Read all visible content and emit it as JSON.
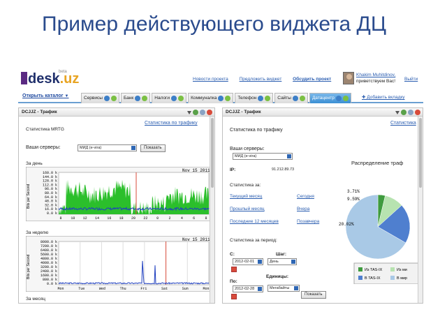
{
  "slide_title": "Пример действующего виджета ДЦ",
  "site": {
    "logo_text": "desk",
    "logo_tld": ".uz",
    "beta": "beta",
    "top_links": [
      "Новости проекта",
      "Предложить виджет",
      "Обсудить проект"
    ],
    "user_name": "Khakim Muhitdinov,",
    "greeting": "приветствуем Вас!",
    "logout": "Выйти",
    "open_catalog": "Открыть каталог",
    "tabs": [
      "Сервисы",
      "Банк",
      "Налоги",
      "Коммуналка",
      "Телефон",
      "Сайты",
      "Датацентр"
    ],
    "active_tab": "Датацентр",
    "add_tab": "Добавить вкладку"
  },
  "left_widget": {
    "title": "DCJJZ - Трафик",
    "stats_link": "Статистика по трафику",
    "heading": "Статистика MRTG",
    "servers_label": "Ваши серверы:",
    "server_value": "МИД (e-vira)",
    "show_button": "Показать",
    "day_label": "За день",
    "week_label": "За неделю",
    "month_label": "За месяц",
    "day_date": "Nov 15 2011",
    "week_date": "Nov 15 2011",
    "day_y_ticks": [
      "160.0 k",
      "144.0 k",
      "128.0 k",
      "112.0 k",
      "96.0 k",
      "80.0 k",
      "64.0 k",
      "48.0 k",
      "32.0 k",
      "16.0 k",
      "0.0 k"
    ],
    "day_x_ticks": [
      "8",
      "10",
      "12",
      "14",
      "16",
      "18",
      "20",
      "22",
      "0",
      "2",
      "4",
      "6",
      "8"
    ],
    "week_y_ticks": [
      "8000.0 k",
      "7200.0 k",
      "6400.0 k",
      "5600.0 k",
      "4800.0 k",
      "4000.0 k",
      "3200.0 k",
      "2400.0 k",
      "1600.0 k",
      "800.0 k",
      "0.0 k"
    ],
    "week_x_ticks": [
      "Mon",
      "Tue",
      "Wed",
      "Thu",
      "Fri",
      "Sat",
      "Sun",
      "Mon"
    ],
    "y_axis_label": "Bits per Second"
  },
  "right_widget": {
    "title": "DCJJZ - Трафик",
    "stats_link": "Статистика",
    "heading": "Статистика по трафику",
    "servers_label": "Ваши серверы:",
    "server_value": "МИД (e-vira)",
    "ip_label": "IP:",
    "ip_value": "91.212.89.73",
    "stats_for": "Статистика за:",
    "period_links": [
      [
        "Текущий месяц",
        "Сегодня"
      ],
      [
        "Прошлый месяц",
        "Вчера"
      ],
      [
        "Последние 12 месяцев",
        "Позавчера"
      ]
    ],
    "period_stats": "Статистика за период:",
    "from_label": "С:",
    "from_value": "2012-02-01",
    "to_label": "По:",
    "to_value": "2012-02-28",
    "step_label": "Шаг:",
    "step_value": "День",
    "units_label": "Единицы:",
    "units_value": "Мегабайты",
    "show_button": "Показать",
    "pie_title": "Распределение траф",
    "pie_values": [
      "3.71%",
      "9.59%",
      "20.02%"
    ],
    "legend": [
      "Из TAS-IX",
      "Из ми",
      "В TAS-IX",
      "В мир"
    ]
  },
  "chart_data": [
    {
      "type": "area",
      "title": "",
      "ylabel": "Bits per Second",
      "ylim": [
        0,
        160000
      ],
      "x_ticks": [
        "8",
        "10",
        "12",
        "14",
        "16",
        "18",
        "20",
        "22",
        "0",
        "2",
        "4",
        "6",
        "8"
      ]
    },
    {
      "type": "line",
      "title": "",
      "ylabel": "Bits per Second",
      "ylim": [
        0,
        8000000
      ],
      "x_ticks": [
        "Mon",
        "Tue",
        "Wed",
        "Thu",
        "Fri",
        "Sat",
        "Sun",
        "Mon"
      ]
    },
    {
      "type": "pie",
      "slices": [
        {
          "label": "Из TAS-IX",
          "value": 3.71
        },
        {
          "label": "Из ми",
          "value": 9.59
        },
        {
          "label": "В TAS-IX",
          "value": 20.02
        },
        {
          "label": "В мир",
          "value": 66.68
        }
      ]
    }
  ],
  "colors": {
    "title": "#2a4b8d",
    "accent": "#3b8fd4",
    "green": "#2bbf2b",
    "blue": "#1f3fbf",
    "red": "#d84b3b"
  }
}
